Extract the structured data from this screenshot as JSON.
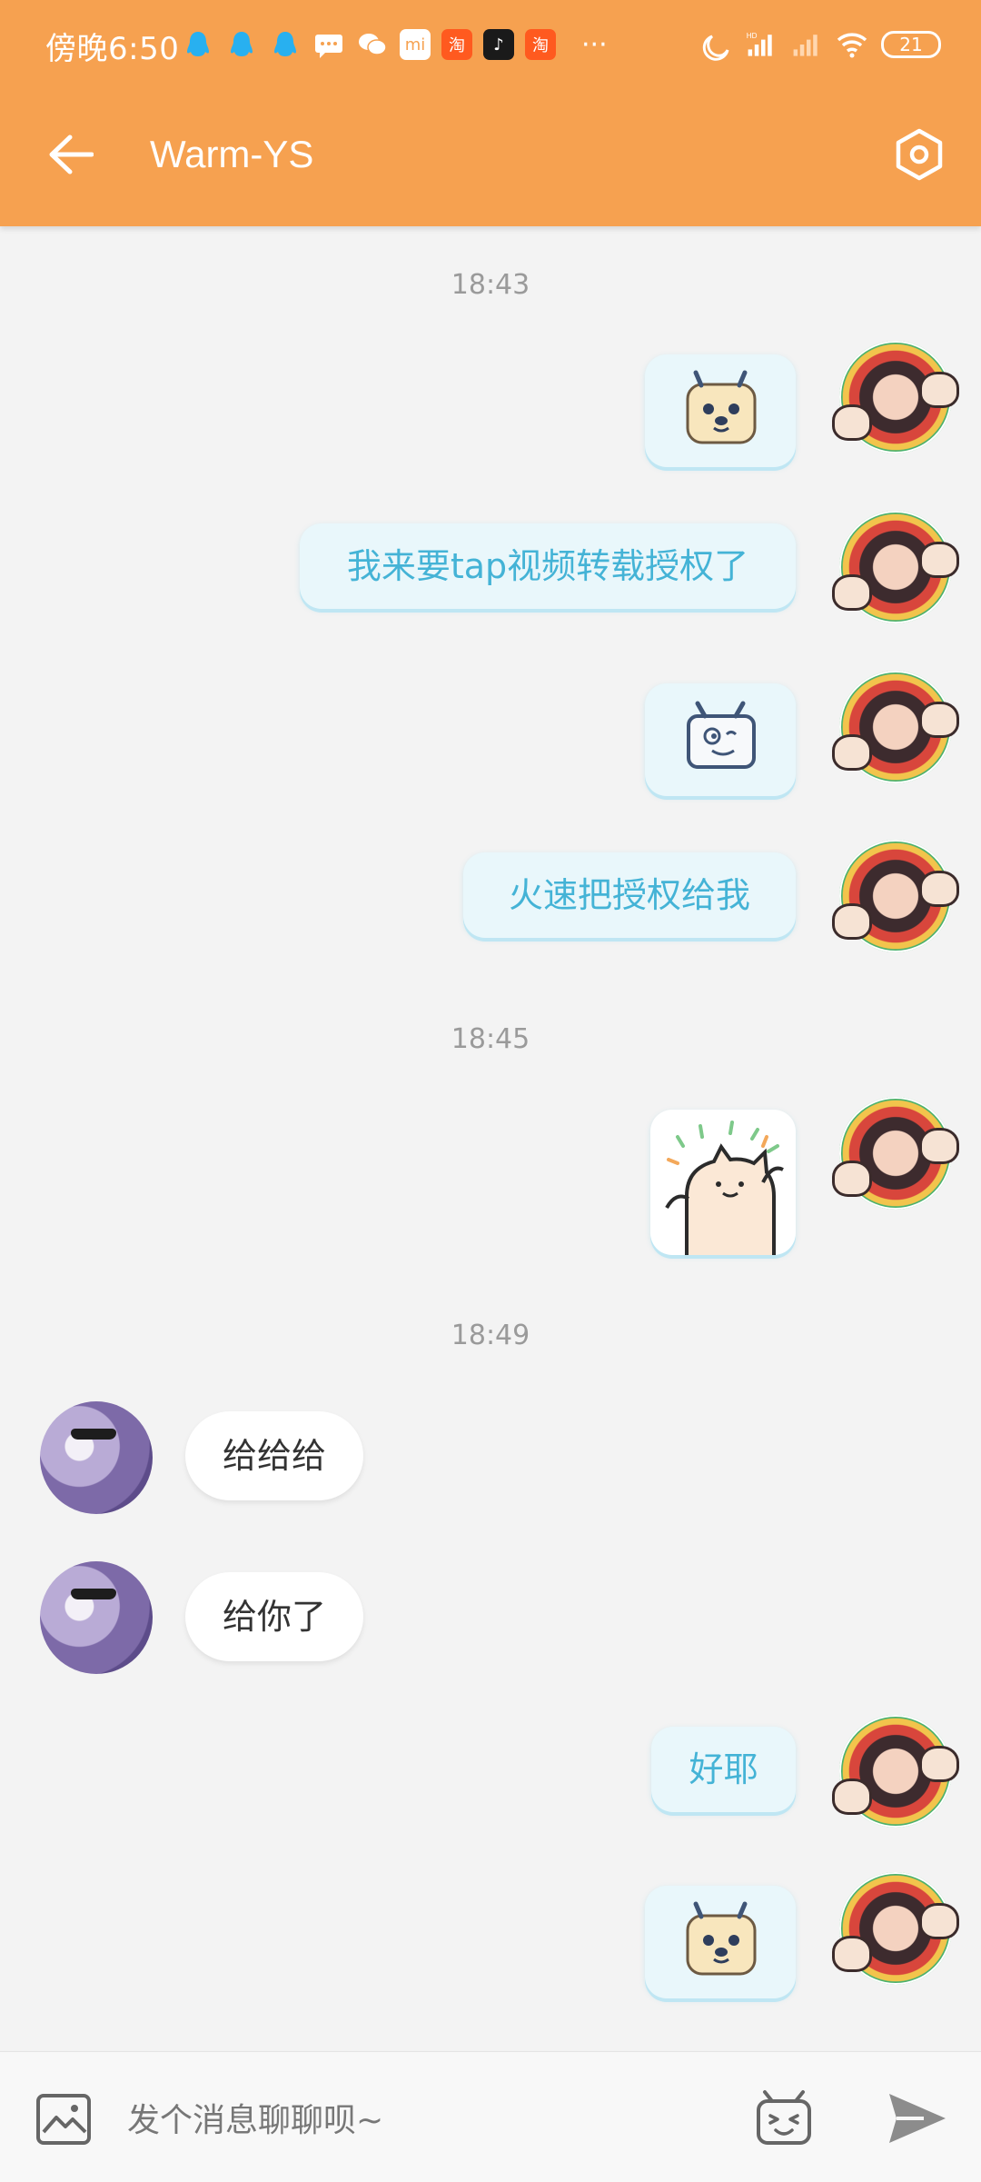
{
  "status": {
    "time": "傍晚6:50",
    "battery": "21",
    "network": "HD",
    "app_icons": [
      "qq-icon",
      "qq-icon",
      "qq-icon",
      "message-icon",
      "wechat-icon",
      "mi-store-icon",
      "taobao-icon",
      "tiktok-icon",
      "taobao-icon"
    ],
    "more": "···"
  },
  "header": {
    "title": "Warm-YS",
    "bg_color": "#f6a150"
  },
  "chat": {
    "timestamps": [
      "18:43",
      "18:45",
      "18:49"
    ],
    "messages": [
      {
        "side": "me",
        "type": "sticker",
        "sticker": "tv-dog-sticker"
      },
      {
        "side": "me",
        "type": "text",
        "text": "我来要tap视频转载授权了"
      },
      {
        "side": "me",
        "type": "sticker",
        "sticker": "tv-smile-sticker"
      },
      {
        "side": "me",
        "type": "text",
        "text": "火速把授权给我"
      },
      {
        "side": "me",
        "type": "sticker",
        "sticker": "happy-cat-sticker"
      },
      {
        "side": "other",
        "type": "text",
        "text": "给给给"
      },
      {
        "side": "other",
        "type": "text",
        "text": "给你了"
      },
      {
        "side": "me",
        "type": "text",
        "text": "好耶"
      },
      {
        "side": "me",
        "type": "sticker",
        "sticker": "tv-dog-sticker"
      }
    ]
  },
  "input": {
    "placeholder": "发个消息聊聊呗~"
  },
  "colors": {
    "accent": "#f6a150",
    "my_bubble_bg": "#e9f7fb",
    "my_bubble_text": "#44b3d6",
    "timestamp": "#9a9a9a"
  }
}
